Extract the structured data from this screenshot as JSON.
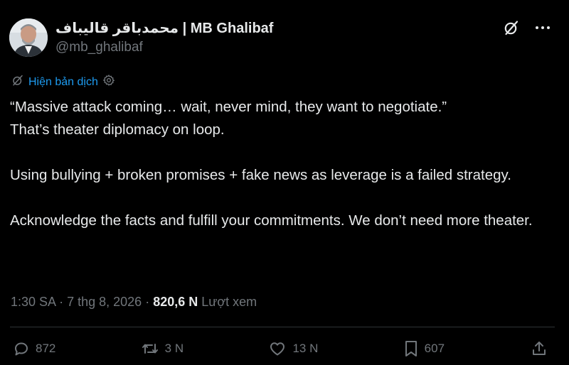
{
  "author": {
    "display_name": "محمدباقر قالیباف | MB Ghalibaf",
    "handle": "@mb_ghalibaf"
  },
  "translate": {
    "label": "Hiện bản dịch"
  },
  "tweet": {
    "paragraphs": [
      "“Massive attack coming… wait, never mind, they want to negotiate.”\nThat’s theater diplomacy on loop.",
      "Using bullying + broken promises + fake news as leverage is a failed strategy.",
      "Acknowledge the facts and fulfill your commitments. We don’t need more theater."
    ]
  },
  "meta": {
    "time": "1:30 SA",
    "separator": "·",
    "date": "7 thg 8, 2026",
    "views_count": "820,6 N",
    "views_label": "Lượt xem"
  },
  "actions": {
    "replies": "872",
    "reposts": "3 N",
    "likes": "13 N",
    "bookmarks": "607"
  },
  "colors": {
    "background": "#000000",
    "text": "#e7e9ea",
    "muted": "#71767b",
    "link": "#1d9bf0",
    "divider": "#2f3336"
  },
  "icons": {
    "grok": "grok-icon",
    "more": "more-icon",
    "translate": "translate-icon",
    "settings": "gear-icon",
    "reply": "reply-icon",
    "repost": "repost-icon",
    "like": "heart-icon",
    "bookmark": "bookmark-icon",
    "share": "share-icon"
  }
}
